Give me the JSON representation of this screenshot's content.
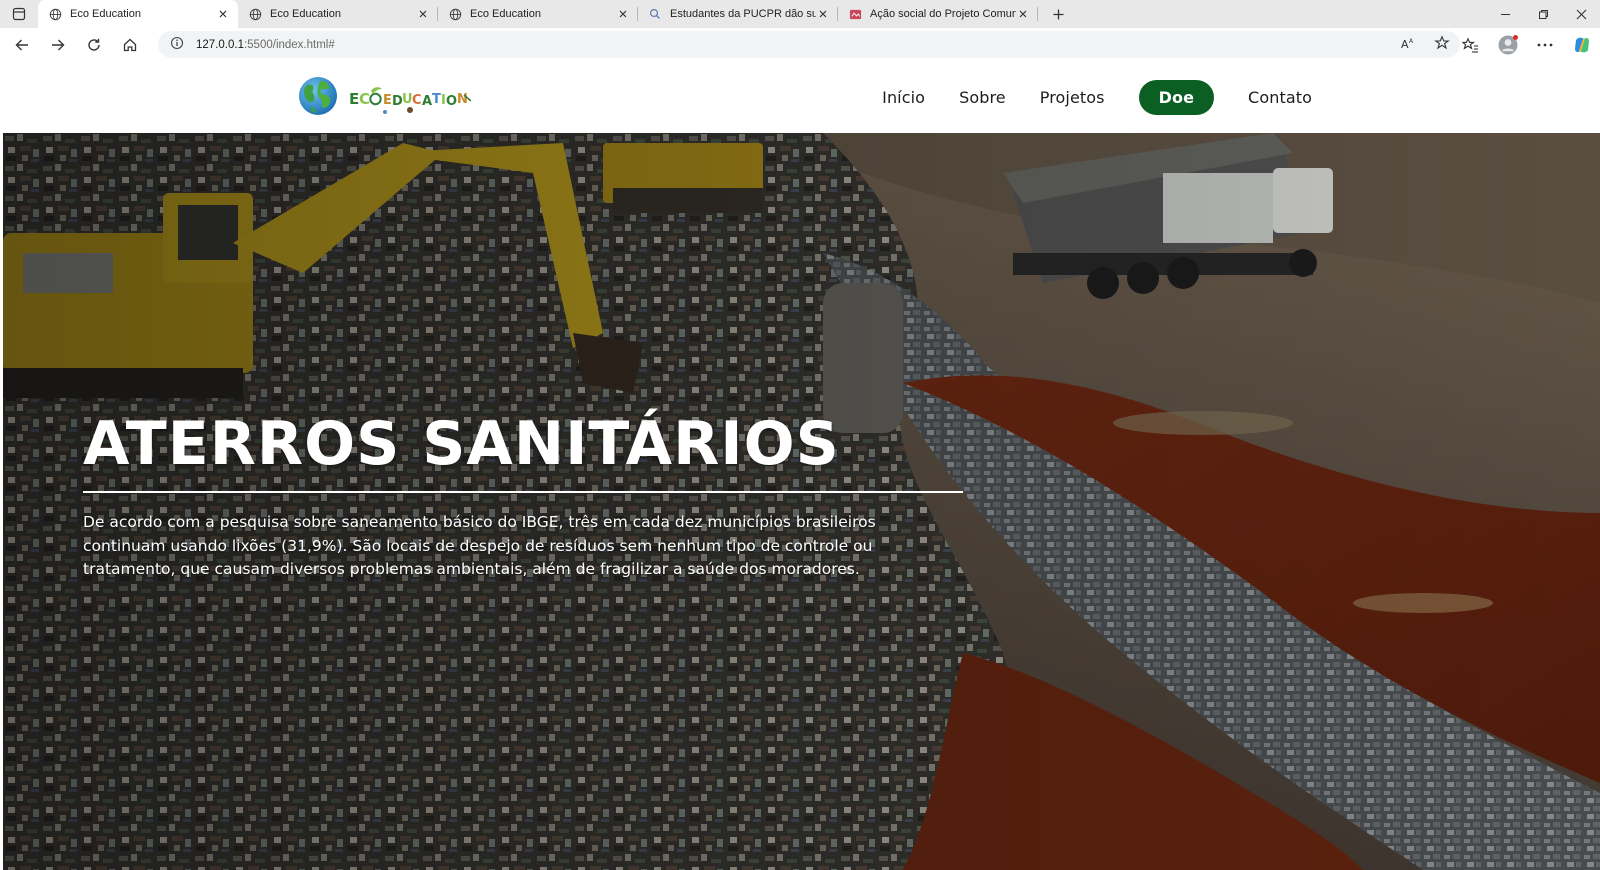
{
  "browser": {
    "tabs": [
      {
        "title": "Eco Education",
        "icon": "globe-icon",
        "active": true
      },
      {
        "title": "Eco Education",
        "icon": "globe-icon",
        "active": false
      },
      {
        "title": "Eco Education",
        "icon": "globe-icon",
        "active": false
      },
      {
        "title": "Estudantes da PUCPR dão suport",
        "icon": "search-icon",
        "active": false
      },
      {
        "title": "Ação social do Projeto Comunitár",
        "icon": "site-favicon-icon",
        "active": false
      }
    ],
    "address": {
      "host": "127.0.0.1",
      "path": ":5500/index.html#"
    },
    "read_aloud_label": "Aᴬ"
  },
  "site": {
    "logo_text": "ECOEDUCATION",
    "nav": [
      {
        "label": "Início"
      },
      {
        "label": "Sobre"
      },
      {
        "label": "Projetos"
      },
      {
        "label": "Doe"
      },
      {
        "label": "Contato"
      }
    ],
    "colors": {
      "cta": "#0c5f23",
      "hero_text": "#ffffff"
    }
  },
  "hero": {
    "title": "ATERROS SANITÁRIOS",
    "description": "De acordo com a pesquisa sobre saneamento básico do IBGE, três em cada dez municípios brasileiros continuam usando lixões (31,9%). São locais de despejo de resíduos sem nenhum tipo de controle ou tratamento, que causam diversos problemas ambientais, além de fragilizar a saúde dos moradores.",
    "image_alt": "Aterro sanitário com escavadeira e caminhões"
  }
}
